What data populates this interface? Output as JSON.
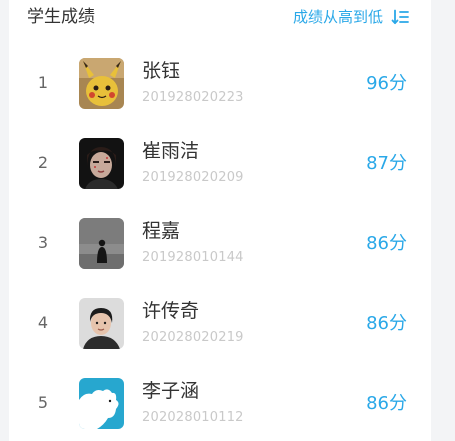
{
  "header": {
    "title": "学生成绩",
    "sort_label": "成绩从高到低"
  },
  "students": [
    {
      "rank": "1",
      "name": "张钰",
      "id": "201928020223",
      "score": "96分"
    },
    {
      "rank": "2",
      "name": "崔雨洁",
      "id": "201928020209",
      "score": "87分"
    },
    {
      "rank": "3",
      "name": "程嘉",
      "id": "201928010144",
      "score": "86分"
    },
    {
      "rank": "4",
      "name": "许传奇",
      "id": "202028020219",
      "score": "86分"
    },
    {
      "rank": "5",
      "name": "李子涵",
      "id": "202028010112",
      "score": "86分"
    }
  ],
  "colors": {
    "accent": "#2aa8e8",
    "text": "#333333",
    "muted": "#c9c9c9"
  }
}
